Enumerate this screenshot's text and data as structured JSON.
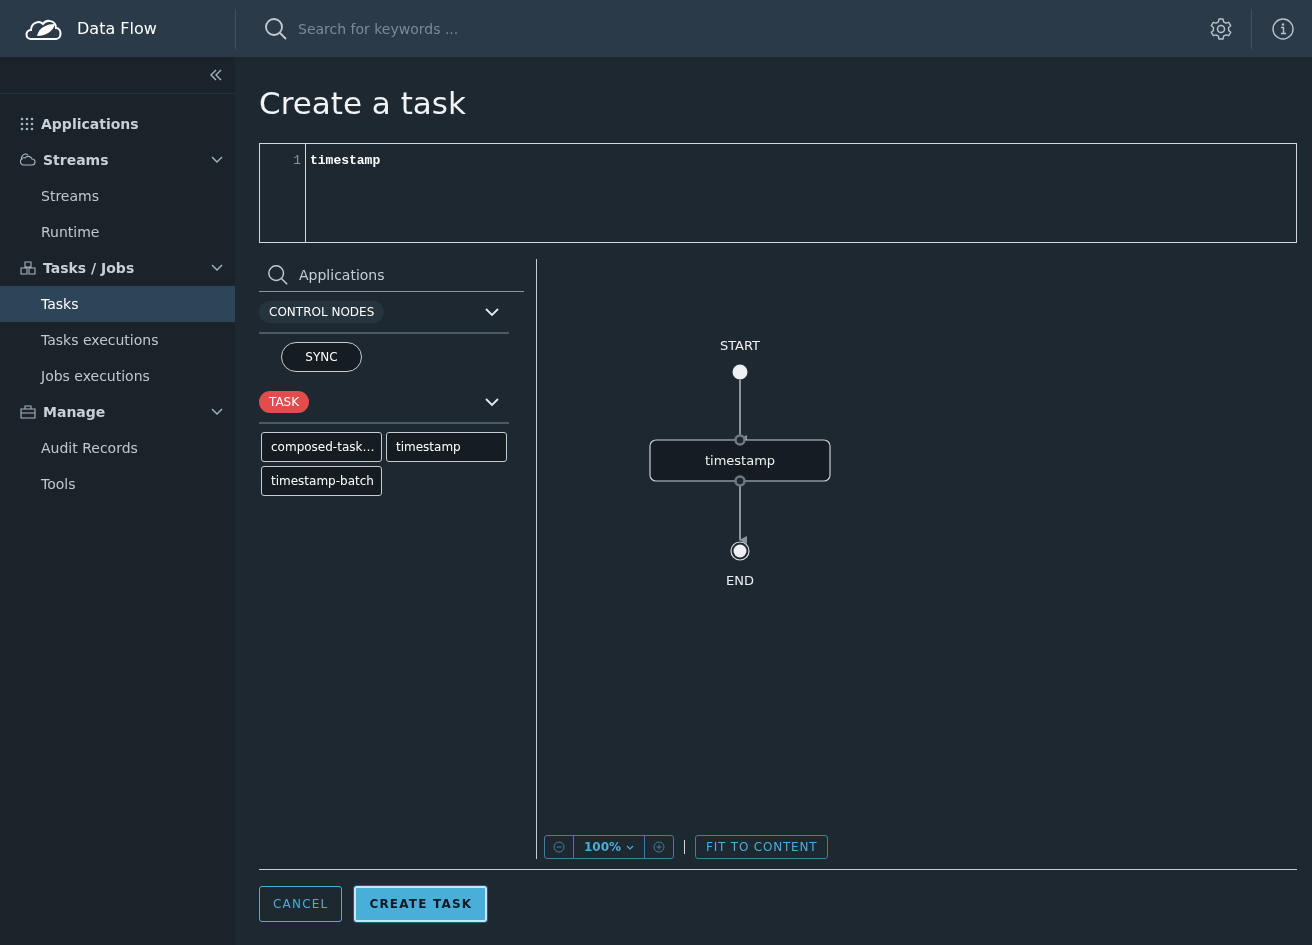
{
  "header": {
    "title": "Data Flow",
    "search": {
      "placeholder": "Search for keywords ..."
    }
  },
  "sidebar": {
    "items": [
      {
        "label": "Applications",
        "kind": "link",
        "selected": false
      },
      {
        "label": "Streams",
        "kind": "group",
        "selected": false,
        "expanded": true,
        "children": [
          {
            "label": "Streams",
            "selected": false
          },
          {
            "label": "Runtime",
            "selected": false
          }
        ]
      },
      {
        "label": "Tasks / Jobs",
        "kind": "group",
        "selected": false,
        "expanded": true,
        "children": [
          {
            "label": "Tasks",
            "selected": true
          },
          {
            "label": "Tasks executions",
            "selected": false
          },
          {
            "label": "Jobs executions",
            "selected": false
          }
        ]
      },
      {
        "label": "Manage",
        "kind": "group",
        "selected": false,
        "expanded": true,
        "children": [
          {
            "label": "Audit Records",
            "selected": false
          },
          {
            "label": "Tools",
            "selected": false
          }
        ]
      }
    ]
  },
  "page": {
    "title": "Create a task",
    "editor": {
      "lines": [
        {
          "number": "1",
          "text": "timestamp"
        }
      ]
    },
    "palette": {
      "search": {
        "placeholder": "Applications"
      },
      "groups": [
        {
          "label": "CONTROL NODES",
          "kind": "control",
          "expanded": true,
          "items": [
            "SYNC"
          ]
        },
        {
          "label": "TASK",
          "kind": "task",
          "expanded": true,
          "items": [
            "composed-task…",
            "timestamp",
            "timestamp-batch"
          ]
        }
      ]
    },
    "canvas": {
      "nodes": [
        {
          "kind": "start",
          "label": "START"
        },
        {
          "kind": "task",
          "label": "timestamp"
        },
        {
          "kind": "end",
          "label": "END"
        }
      ],
      "zoom": "100%",
      "fit_button": "FIT TO CONTENT"
    },
    "buttons": [
      {
        "label": "CANCEL",
        "kind": "secondary"
      },
      {
        "label": "CREATE TASK",
        "kind": "primary"
      }
    ]
  }
}
